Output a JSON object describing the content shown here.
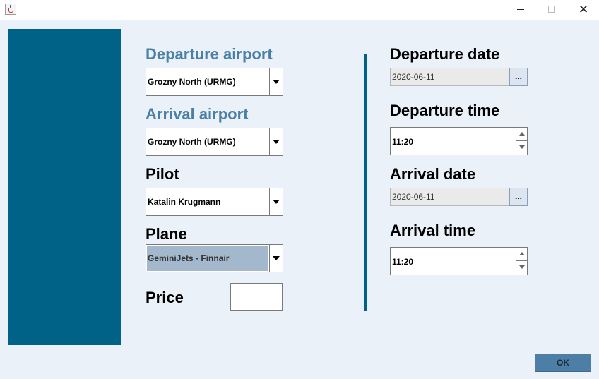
{
  "window": {
    "icon": "java-cup-icon",
    "minimize_icon": "minimize-icon",
    "maximize_icon": "maximize-icon",
    "close_symbol": "✕"
  },
  "colors": {
    "side_panel": "#006287",
    "background": "#ebf1f9",
    "label_blue": "#4a7fa6",
    "ok_button": "#4d7ea6",
    "selected_combo": "#a3b8cc"
  },
  "form": {
    "departure_airport": {
      "label": "Departure airport",
      "value": "Grozny North (URMG)"
    },
    "arrival_airport": {
      "label": "Arrival airport",
      "value": "Grozny North (URMG)"
    },
    "pilot": {
      "label": "Pilot",
      "value": "Katalin Krugmann"
    },
    "plane": {
      "label": "Plane",
      "value": "GeminiJets - Finnair"
    },
    "price": {
      "label": "Price",
      "value": ""
    },
    "departure_date": {
      "label": "Departure date",
      "value": "2020-06-11",
      "button": "..."
    },
    "departure_time": {
      "label": "Departure time",
      "value": "11:20"
    },
    "arrival_date": {
      "label": "Arrival date",
      "value": "2020-06-11",
      "button": "..."
    },
    "arrival_time": {
      "label": "Arrival time",
      "value": "11:20"
    }
  },
  "footer": {
    "ok_label": "OK"
  }
}
